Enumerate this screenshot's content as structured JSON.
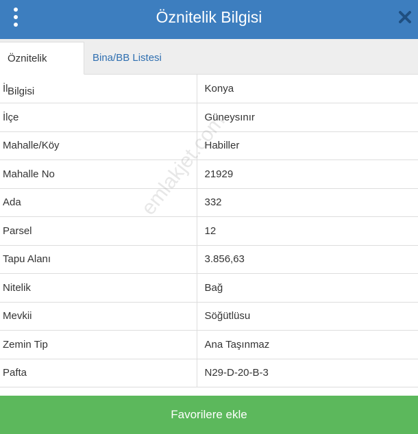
{
  "header": {
    "title": "Öznitelik Bilgisi",
    "menu_icon": "vertical-ellipsis-icon",
    "close_icon": "close-icon"
  },
  "tabs": [
    {
      "label": "Öznitelik Bilgisi",
      "active": true
    },
    {
      "label": "Bina/BB Listesi",
      "active": false
    }
  ],
  "rows": [
    {
      "key": "İl",
      "value": "Konya"
    },
    {
      "key": "İlçe",
      "value": "Güneysınır"
    },
    {
      "key": "Mahalle/Köy",
      "value": "Habiller"
    },
    {
      "key": "Mahalle No",
      "value": "21929"
    },
    {
      "key": "Ada",
      "value": "332"
    },
    {
      "key": "Parsel",
      "value": "12"
    },
    {
      "key": "Tapu Alanı",
      "value": "3.856,63"
    },
    {
      "key": "Nitelik",
      "value": "Bağ"
    },
    {
      "key": "Mevkii",
      "value": "Söğütlüsu"
    },
    {
      "key": "Zemin Tip",
      "value": "Ana Taşınmaz"
    },
    {
      "key": "Pafta",
      "value": "N29-D-20-B-3"
    }
  ],
  "watermark": "emlakjet.com",
  "footer": {
    "label": "Favorilere ekle"
  },
  "colors": {
    "header": "#3d7ebf",
    "footer": "#5cb85c",
    "tab_link": "#2f6fb0"
  }
}
